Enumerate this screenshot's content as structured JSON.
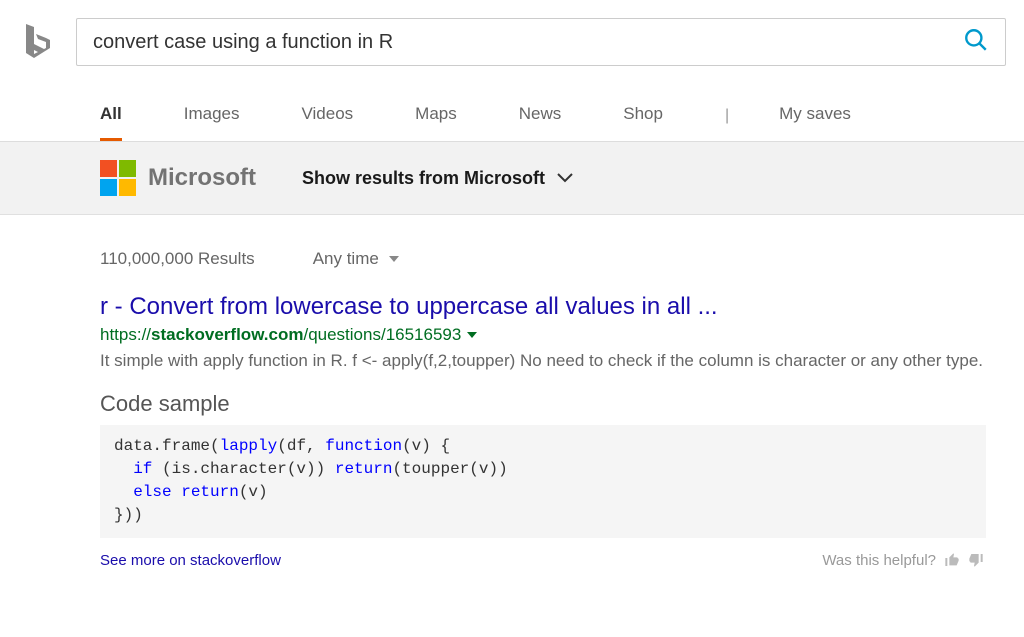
{
  "search": {
    "query": "convert case using a function in R"
  },
  "tabs": {
    "all": "All",
    "images": "Images",
    "videos": "Videos",
    "maps": "Maps",
    "news": "News",
    "shop": "Shop",
    "mysaves": "My saves"
  },
  "brand": {
    "name": "Microsoft",
    "toggle": "Show results from Microsoft"
  },
  "meta": {
    "count": "110,000,000 Results",
    "anytime": "Any time"
  },
  "result": {
    "title": "r - Convert from lowercase to uppercase all values in all ...",
    "url_prefix": "https://",
    "url_domain": "stackoverflow.com",
    "url_path": "/questions/16516593",
    "snippet": "It simple with apply function in R. f <- apply(f,2,toupper) No need to check if the column is character or any other type."
  },
  "code": {
    "heading": "Code sample",
    "line1a": "data.frame(",
    "line1b": "lapply",
    "line1c": "(df, ",
    "line1d": "function",
    "line1e": "(v) {",
    "line2a": "  if",
    "line2b": " (is.character(v)) ",
    "line2c": "return",
    "line2d": "(toupper(v))",
    "line3a": "  else",
    "line3b": " return",
    "line3c": "(v)",
    "line4": "}))"
  },
  "footer": {
    "see_more": "See more on stackoverflow",
    "helpful": "Was this helpful?"
  }
}
